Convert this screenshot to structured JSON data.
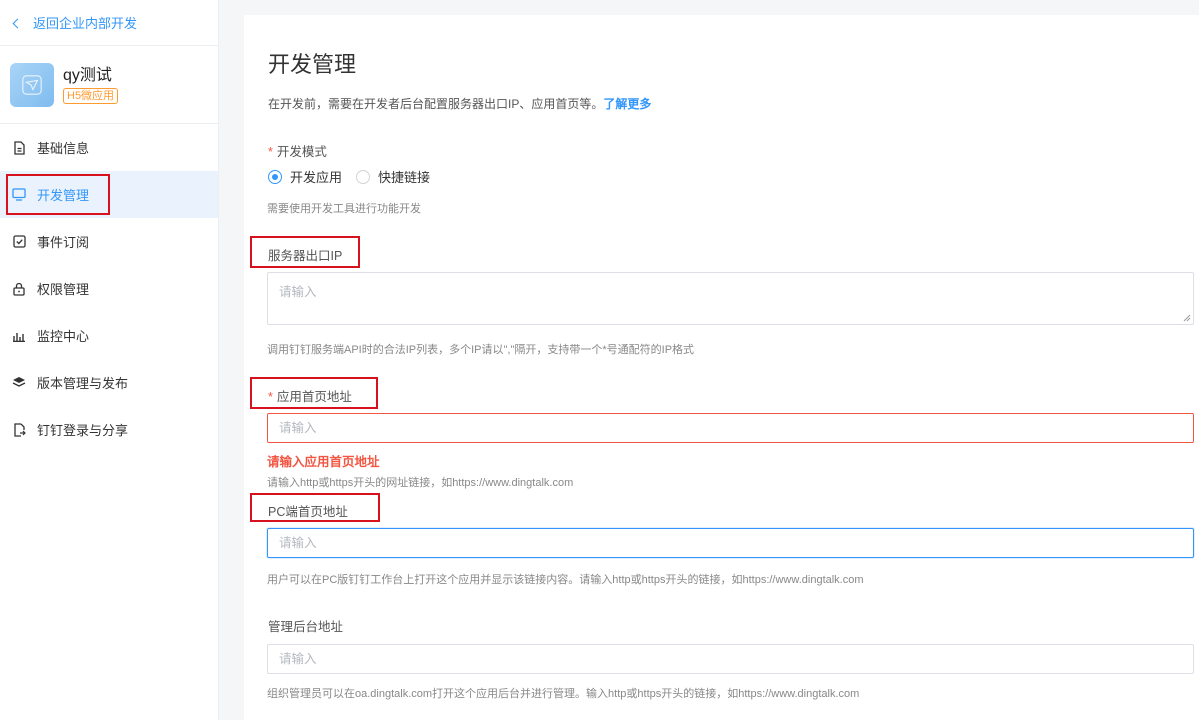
{
  "sidebar": {
    "back_label": "返回企业内部开发",
    "app": {
      "name": "qy测试",
      "badge": "H5微应用"
    },
    "items": [
      {
        "label": "基础信息",
        "icon": "document-icon"
      },
      {
        "label": "开发管理",
        "icon": "monitor-icon",
        "active": true
      },
      {
        "label": "事件订阅",
        "icon": "check-square-icon"
      },
      {
        "label": "权限管理",
        "icon": "lock-icon"
      },
      {
        "label": "监控中心",
        "icon": "bar-chart-icon"
      },
      {
        "label": "版本管理与发布",
        "icon": "layers-icon"
      },
      {
        "label": "钉钉登录与分享",
        "icon": "share-doc-icon"
      }
    ]
  },
  "main": {
    "title": "开发管理",
    "intro": "在开发前，需要在开发者后台配置服务器出口IP、应用首页等。",
    "intro_link": "了解更多",
    "dev_mode": {
      "label": "开发模式",
      "options": [
        "开发应用",
        "快捷链接"
      ],
      "selected": "开发应用",
      "hint": "需要使用开发工具进行功能开发"
    },
    "server_ip": {
      "label": "服务器出口IP",
      "placeholder": "请输入",
      "hint": "调用钉钉服务端API时的合法IP列表，多个IP请以\",\"隔开，支持带一个*号通配符的IP格式"
    },
    "home_url": {
      "label": "应用首页地址",
      "placeholder": "请输入",
      "error": "请输入应用首页地址",
      "hint": "请输入http或https开头的网址链接，如https://www.dingtalk.com"
    },
    "pc_home_url": {
      "label": "PC端首页地址",
      "placeholder": "请输入",
      "hint": "用户可以在PC版钉钉工作台上打开这个应用并显示该链接内容。请输入http或https开头的链接，如https://www.dingtalk.com"
    },
    "admin_url": {
      "label": "管理后台地址",
      "placeholder": "请输入",
      "hint": "组织管理员可以在oa.dingtalk.com打开这个应用后台并进行管理。输入http或https开头的链接，如https://www.dingtalk.com"
    }
  },
  "colors": {
    "accent": "#3296fa",
    "error": "#f25643",
    "highlight": "#d8111f"
  }
}
